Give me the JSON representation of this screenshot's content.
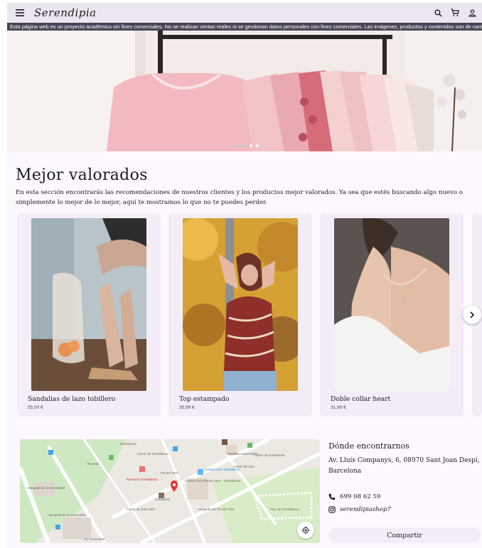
{
  "header": {
    "logo": "Serendipia",
    "icons": [
      "menu-icon",
      "search-icon",
      "cart-icon",
      "account-icon"
    ]
  },
  "notice": {
    "text": "Esta página web es un proyecto académico sin fines comerciales. No se realizan ventas reales ni se gestionan datos personales con fines comerciales. Las imágenes, productos y contenidos son de carácter demo"
  },
  "carousel": {
    "slides": 3,
    "active_index": 0
  },
  "best_rated": {
    "title": "Mejor valorados",
    "description": "En esta sección encontrarás las recomendaciones de nuestros clientes y los productos mejor valorados. Ya sea que estés buscando algo nuevo o simplemente lo mejor de lo mejor, aquí te mostramos lo que no te puedes perder.",
    "products": [
      {
        "name": "Sandalias de lazo tobillero",
        "price": "55,00 €"
      },
      {
        "name": "Top estampado",
        "price": "35,99 €"
      },
      {
        "name": "Doble collar heart",
        "price": "31,99 €"
      }
    ]
  },
  "location": {
    "title": "Dónde encontrarnos",
    "address": "Av. Lluís Companys, 6, 08970 Sant Joan Despí, Barcelona",
    "phone": "699 08 62 59",
    "instagram": "serendipiashop7",
    "share_label": "Compartir",
    "map_labels": [
      "Avinguda de la Generalitat",
      "Carrer de Torreblanca",
      "Pla del Vent",
      "Farmàcia Torreblanca",
      "Caixabank",
      "Centre Cívic Torreblanca",
      "Centre Cívic Pla del Vent - Torreblanca",
      "Església Santa Maria",
      "Avinguda del Pla del Vent",
      "Carrer del Mas",
      "Carrer de la Marineta",
      "Roserar",
      "Torreblanca",
      "Avinguda de la Generalitat",
      "Parc de Torreblanca",
      "Av. Generalitat",
      "Carrer de Joan Miró"
    ]
  },
  "colors": {
    "header_bg": "#ece6f0",
    "notice_bg": "#4a4458",
    "page_bg": "#fdf7ff",
    "card_bg": "#f3edf7"
  }
}
